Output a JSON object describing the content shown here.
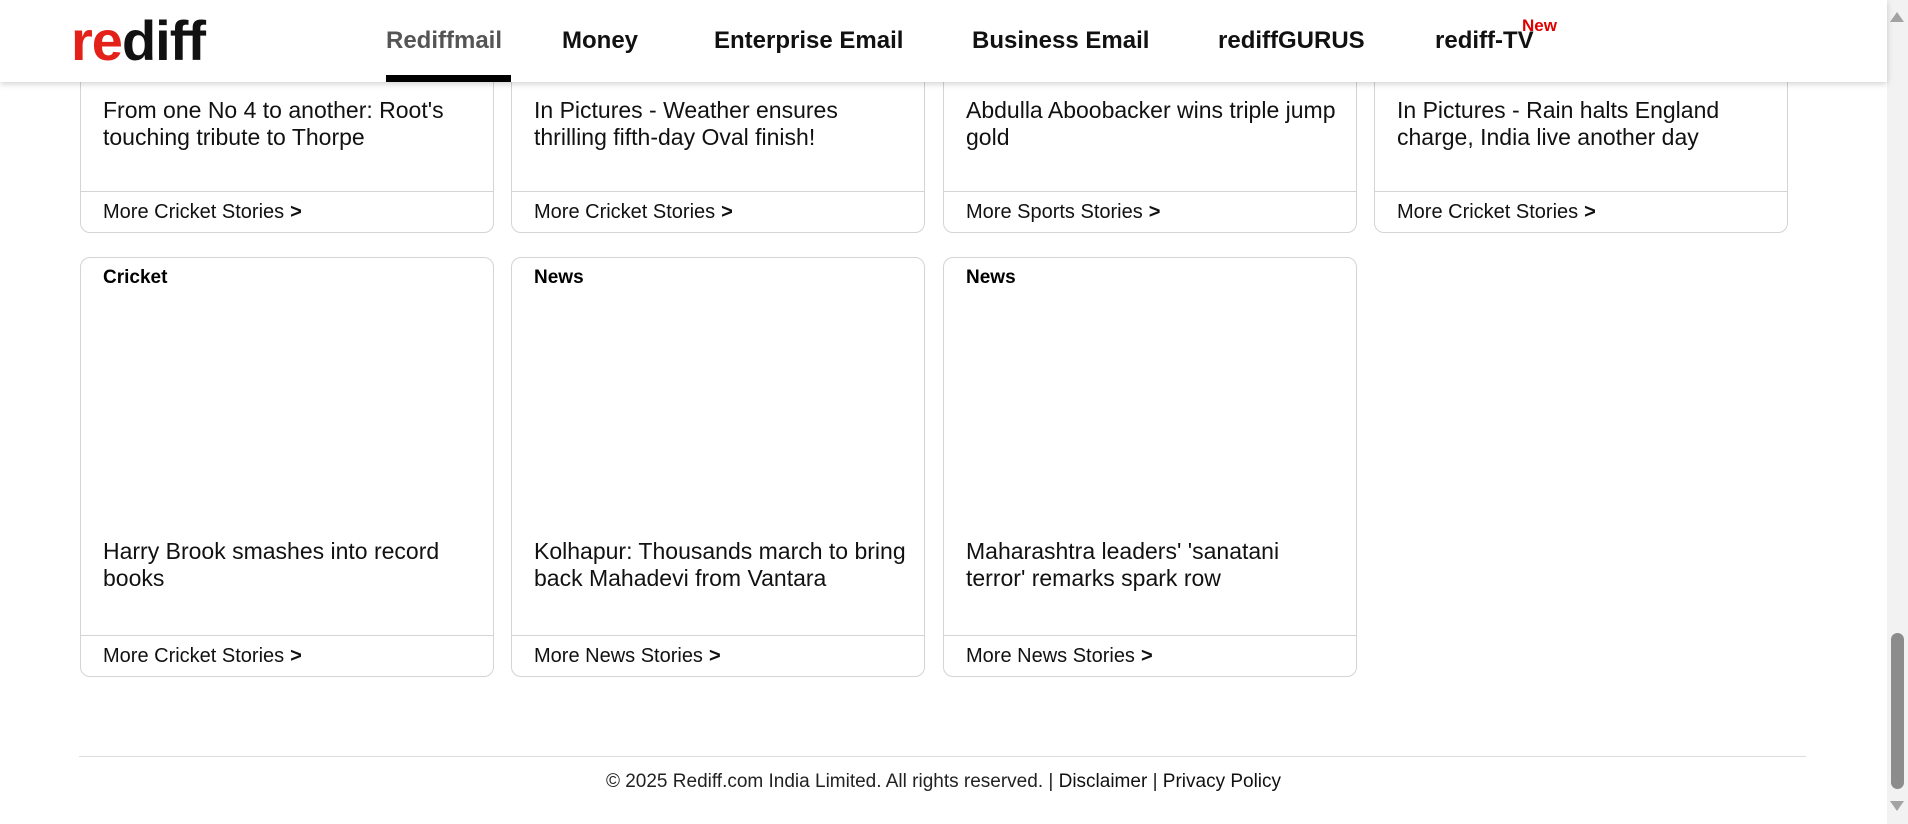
{
  "header": {
    "logo_text": "rediff",
    "logo_color": "#e32119",
    "nav": [
      {
        "label": "Rediffmail",
        "active": true
      },
      {
        "label": "Money"
      },
      {
        "label": "Enterprise Email"
      },
      {
        "label": "Business Email"
      },
      {
        "label": "rediffGURUS"
      },
      {
        "label": "rediff-TV",
        "badge": "New"
      }
    ]
  },
  "cards_row1": [
    {
      "headline": "From one No 4 to another: Root's touching tribute to Thorpe",
      "more": "More Cricket Stories",
      "chevron": ">"
    },
    {
      "headline": "In Pictures - Weather ensures thrilling fifth-day Oval finish!",
      "more": "More Cricket Stories",
      "chevron": ">"
    },
    {
      "headline": "Abdulla Aboobacker wins triple jump gold",
      "more": "More Sports Stories",
      "chevron": ">"
    },
    {
      "headline": "In Pictures - Rain halts England charge, India live another day",
      "more": "More Cricket Stories",
      "chevron": ">"
    }
  ],
  "cards_row2": [
    {
      "category": "Cricket",
      "headline": "Harry Brook smashes into record books",
      "more": "More Cricket Stories",
      "chevron": ">"
    },
    {
      "category": "News",
      "headline": "Kolhapur: Thousands march to bring back Mahadevi from Vantara",
      "more": "More News Stories",
      "chevron": ">"
    },
    {
      "category": "News",
      "headline": "Maharashtra leaders' 'sanatani terror' remarks spark row",
      "more": "More News Stories",
      "chevron": ">"
    }
  ],
  "footer": {
    "copyright": "© 2025 Rediff.com India Limited. All rights reserved.",
    "separator": "|",
    "disclaimer": "Disclaimer",
    "privacy": "Privacy Policy"
  }
}
